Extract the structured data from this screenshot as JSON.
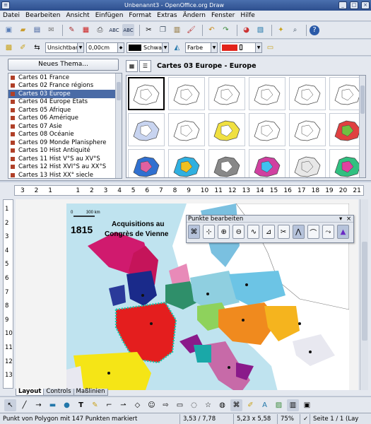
{
  "window": {
    "title": "Unbenannt3 - OpenOffice.org Draw"
  },
  "menu": [
    "Datei",
    "Bearbeiten",
    "Ansicht",
    "Einfügen",
    "Format",
    "Extras",
    "Ändern",
    "Fenster",
    "Hilfe"
  ],
  "line_toolbar": {
    "line_style": "Unsichtbar",
    "line_width": "0,00cm",
    "line_color": "Schwar",
    "area_style": "Farbe",
    "area_color": "Rot"
  },
  "gallery": {
    "new_theme_label": "Neues Thema...",
    "selected_theme_title": "Cartes 03 Europe - Europe",
    "themes": [
      "Cartes 01 France",
      "Cartes 02 France régions",
      "Cartes 03 Europe",
      "Cartes 04 Europe Etats",
      "Cartes 05 Afrique",
      "Cartes 06 Amérique",
      "Cartes 07 Asie",
      "Cartes 08 Océanie",
      "Cartes 09 Monde Planisphere",
      "Cartes 10 Hist Antiquité",
      "Cartes 11  Hist V°S au XV°S",
      "Cartes 12 Hist XVI°S au XX°S",
      "Cartes 13 Hist XX° siecle"
    ],
    "selected_index": 2
  },
  "ruler": {
    "h_ticks": [
      "3",
      "2",
      "1",
      "",
      "1",
      "2",
      "3",
      "4",
      "5",
      "6",
      "7",
      "8",
      "9",
      "10",
      "11",
      "12",
      "13",
      "14",
      "15",
      "16",
      "17",
      "18",
      "19",
      "20",
      "21"
    ],
    "v_ticks": [
      "1",
      "2",
      "3",
      "4",
      "5",
      "6",
      "7",
      "8",
      "9",
      "10",
      "11",
      "12",
      "13"
    ]
  },
  "map": {
    "year": "1815",
    "title_line1": "Acquisitions au",
    "title_line2": "Congrès de Vienne",
    "scale_start": "0",
    "scale_end": "300 km"
  },
  "edit_points_panel": {
    "title": "Punkte bearbeiten"
  },
  "tabs": [
    "Layout",
    "Controls",
    "Maßlinien"
  ],
  "status": {
    "message": "Punkt von Polygon mit 147 Punkten markiert",
    "position": "3,53 / 7,78",
    "size": "5,23 x 5,58",
    "zoom": "75%",
    "page": "Seite 1 / 1 (Lay"
  }
}
